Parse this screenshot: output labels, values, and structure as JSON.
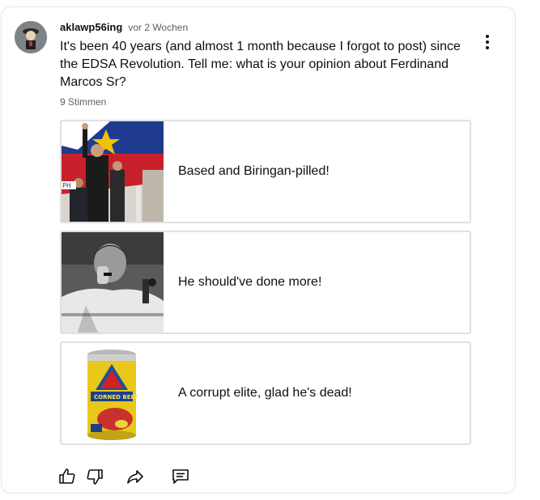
{
  "post": {
    "author": "aklawp56ing",
    "time": "vor 2 Wochen",
    "text": "It's been 40 years (and almost 1 month because I forgot to post) since the EDSA Revolution. Tell me: what is your opinion about Ferdinand Marcos Sr?",
    "votes": "9 Stimmen"
  },
  "poll": {
    "options": [
      {
        "label": "Based and Biringan-pilled!",
        "image": "marcos-waving-photo"
      },
      {
        "label": "He should've done more!",
        "image": "marcos-black-and-white-photo"
      },
      {
        "label": "A corrupt elite, glad he's dead!",
        "image": "corned-beef-can-photo"
      }
    ]
  },
  "actions": {
    "icons": [
      "thumbs-up-icon",
      "thumbs-down-icon",
      "share-icon",
      "comment-icon"
    ]
  }
}
